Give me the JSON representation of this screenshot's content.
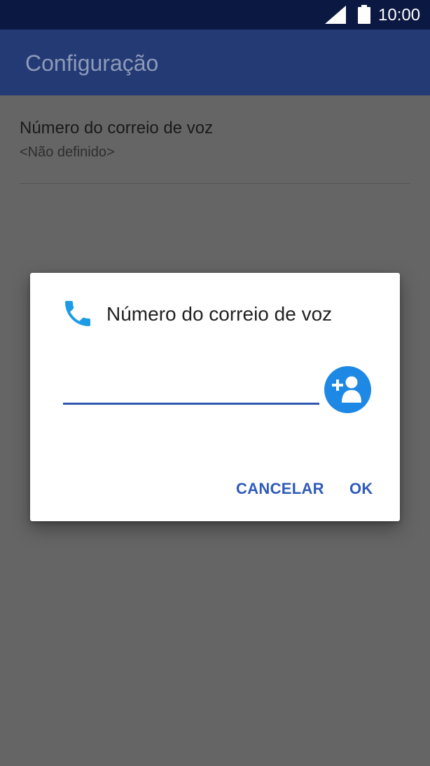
{
  "status_bar": {
    "time": "10:00",
    "icons": [
      "signal-icon",
      "battery-icon"
    ]
  },
  "app_bar": {
    "title": "Configuração"
  },
  "settings": {
    "items": [
      {
        "title": "Número do correio de voz",
        "summary": "<Não definido>"
      }
    ]
  },
  "dialog": {
    "icon": "phone-icon",
    "title": "Número do correio de voz",
    "input_value": "",
    "add_contact_icon": "add-contact-icon",
    "cancel_label": "CANCELAR",
    "ok_label": "OK"
  },
  "colors": {
    "status_bar": "#0b1842",
    "app_bar": "#243a74",
    "scrim": "#656565",
    "accent": "#2f57b0",
    "button_text": "#2e5bb8",
    "phone_icon": "#1e9be6",
    "add_contact_bg": "#1e88e5"
  }
}
